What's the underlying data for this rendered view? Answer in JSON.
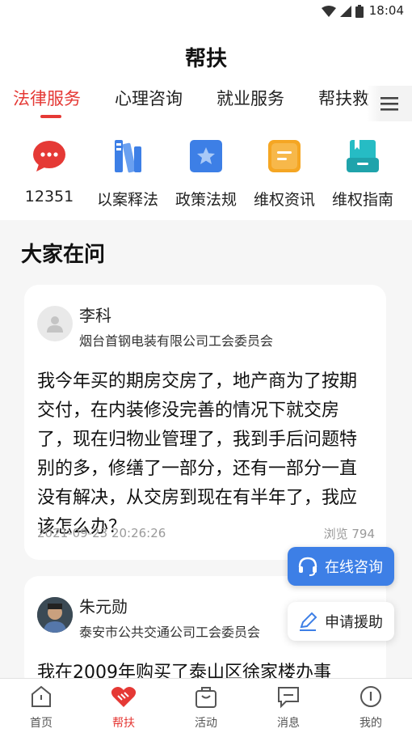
{
  "status_bar": {
    "time": "18:04"
  },
  "header": {
    "title": "帮扶"
  },
  "tabs": [
    {
      "label": "法律服务",
      "active": true
    },
    {
      "label": "心理咨询",
      "active": false
    },
    {
      "label": "就业服务",
      "active": false
    },
    {
      "label": "帮扶救",
      "active": false
    }
  ],
  "shortcuts": [
    {
      "label": "12351",
      "icon": "chat-bubble-icon",
      "color": "#e53935"
    },
    {
      "label": "以案释法",
      "icon": "books-icon",
      "color": "#3d7fe6"
    },
    {
      "label": "政策法规",
      "icon": "star-badge-icon",
      "color": "#3d7fe6"
    },
    {
      "label": "维权资讯",
      "icon": "note-icon",
      "color": "#f5a623"
    },
    {
      "label": "维权指南",
      "icon": "bookmark-box-icon",
      "color": "#26bcc4"
    }
  ],
  "section": {
    "title": "大家在问"
  },
  "posts": [
    {
      "author": "李科",
      "org": "烟台首钢电装有限公司工会委员会",
      "question": "我今年买的期房交房了，地产商为了按期交付，在内装修没完善的情况下就交房了，现在归物业管理了，我到手后问题特别的多，修缮了一部分，还有一部分一直没有解决，从交房到现在有半年了，我应该怎么办？",
      "date": "2021-09-23 20:26:26",
      "views_label": "浏览",
      "views": "794"
    },
    {
      "author": "朱元勋",
      "org": "泰安市公共交通公司工会委员会",
      "question": "我在2009年购买了泰山区徐家楼办事"
    }
  ],
  "fabs": {
    "consult": "在线咨询",
    "apply": "申请援助"
  },
  "bottom_nav": [
    {
      "label": "首页",
      "icon": "home-icon",
      "active": false
    },
    {
      "label": "帮扶",
      "icon": "handshake-icon",
      "active": true
    },
    {
      "label": "活动",
      "icon": "bag-icon",
      "active": false
    },
    {
      "label": "消息",
      "icon": "message-icon",
      "active": false
    },
    {
      "label": "我的",
      "icon": "profile-icon",
      "active": false
    }
  ],
  "colors": {
    "accent": "#e53935",
    "primary": "#3d7fe6"
  }
}
